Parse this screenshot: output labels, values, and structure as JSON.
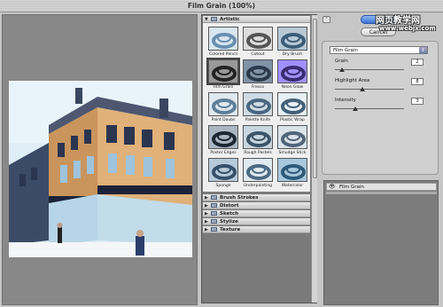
{
  "window": {
    "title": "Film Grain (100%)"
  },
  "watermark": {
    "line1": "网页教学网",
    "line2": "www.webjx.com"
  },
  "buttons": {
    "ok": "",
    "cancel": "Cancel",
    "collapse_icon": "chevron-up-icon"
  },
  "categories": {
    "artistic": "Artistic",
    "collapsed": [
      "Brush Strokes",
      "Distort",
      "Sketch",
      "Stylize",
      "Texture"
    ]
  },
  "thumbnails": [
    {
      "label": "Colored Pencil",
      "selected": false
    },
    {
      "label": "Cutout",
      "selected": false
    },
    {
      "label": "Dry Brush",
      "selected": false
    },
    {
      "label": "Film Grain",
      "selected": true
    },
    {
      "label": "Fresco",
      "selected": false
    },
    {
      "label": "Neon Glow",
      "selected": false
    },
    {
      "label": "Paint Daubs",
      "selected": false
    },
    {
      "label": "Palette Knife",
      "selected": false
    },
    {
      "label": "Plastic Wrap",
      "selected": false
    },
    {
      "label": "Poster Edges",
      "selected": false
    },
    {
      "label": "Rough Pastels",
      "selected": false
    },
    {
      "label": "Smudge Stick",
      "selected": false
    },
    {
      "label": "Sponge",
      "selected": false
    },
    {
      "label": "Underpainting",
      "selected": false
    },
    {
      "label": "Watercolor",
      "selected": false
    }
  ],
  "settings": {
    "filter_select": "Film Grain",
    "params": [
      {
        "label": "Grain",
        "value": "2",
        "fraction": 0.1
      },
      {
        "label": "Highlight Area",
        "value": "8",
        "fraction": 0.4
      },
      {
        "label": "Intensity",
        "value": "3",
        "fraction": 0.3
      }
    ]
  },
  "layers": {
    "item": "Film Grain"
  },
  "colors": {
    "ok_button": "#3d74d6",
    "preview_bg": "#888888"
  }
}
